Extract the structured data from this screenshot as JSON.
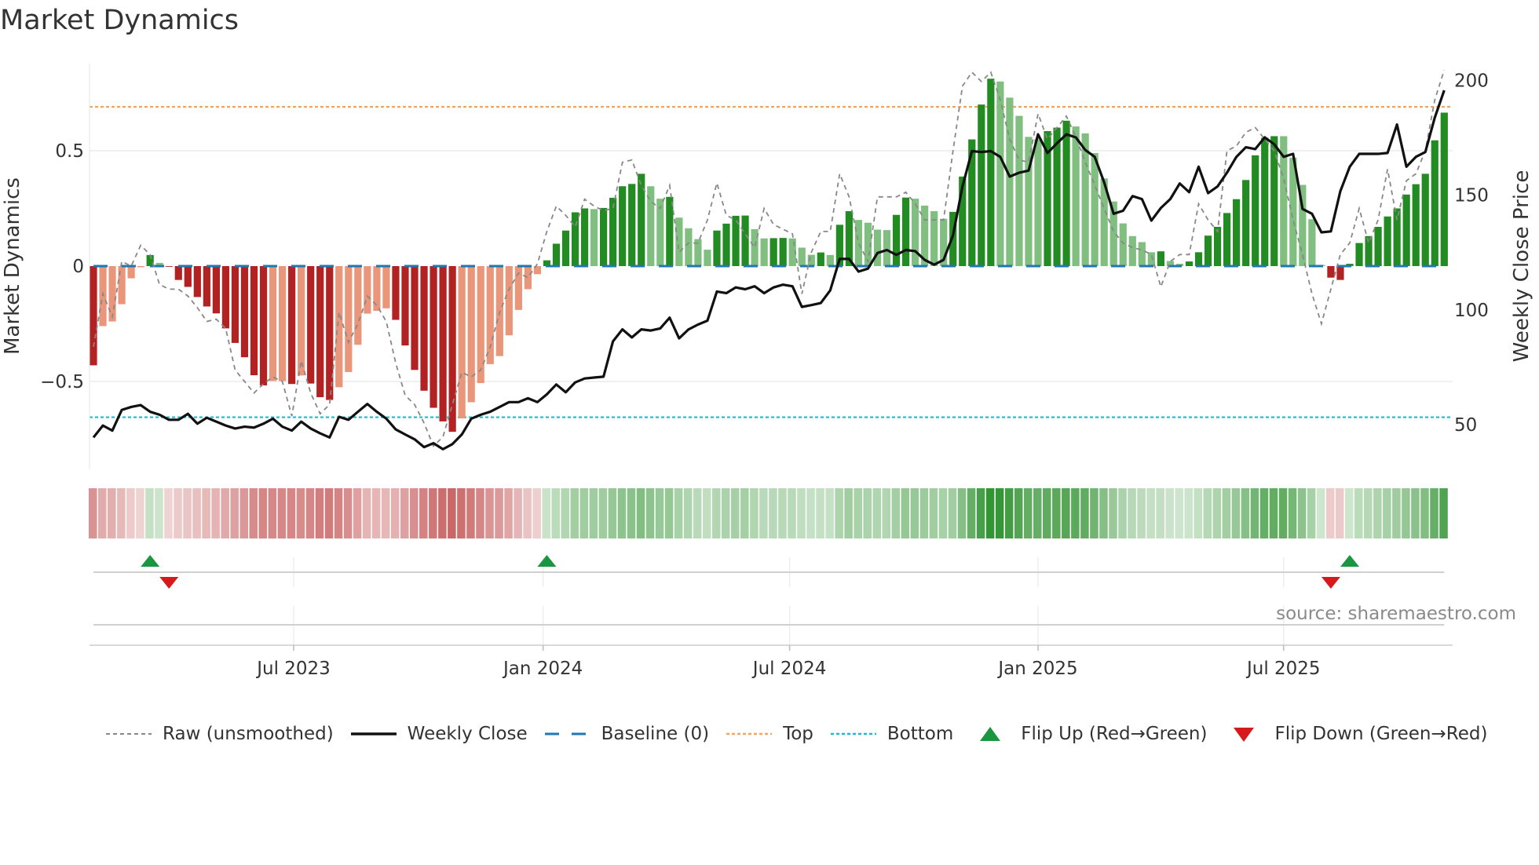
{
  "title": "Market Dynamics",
  "source": "source: sharemaestro.com",
  "legend": {
    "raw": "Raw (unsmoothed)",
    "close": "Weekly Close",
    "baseline": "Baseline (0)",
    "top": "Top",
    "bottom": "Bottom",
    "flip_up": "Flip Up (Red→Green)",
    "flip_down": "Flip Down (Green→Red)"
  },
  "colors": {
    "pos_strong": "#228b22",
    "pos_weak": "#80bf80",
    "neg_strong": "#b22222",
    "neg_weak": "#e9967a",
    "baseline": "#1f77b4",
    "top": "#f4a460",
    "bottom": "#17becf",
    "raw": "#888888",
    "close": "#111111",
    "flip_up": "#1a9641",
    "flip_down": "#d7191c"
  },
  "chart_data": {
    "type": "bar",
    "title": "Market Dynamics",
    "ylabel": "Market Dynamics",
    "y2label": "Weekly Close Price",
    "ylim": [
      -0.86,
      0.88
    ],
    "y2lim": [
      34,
      207
    ],
    "yticks": [
      {
        "v": 0.5,
        "label": "0.5"
      },
      {
        "v": 0,
        "label": "0"
      },
      {
        "v": -0.5,
        "label": "−0.5"
      }
    ],
    "y2ticks": [
      {
        "v": 200,
        "label": "200"
      },
      {
        "v": 150,
        "label": "150"
      },
      {
        "v": 100,
        "label": "100"
      },
      {
        "v": 50,
        "label": "50"
      }
    ],
    "xticks": [
      {
        "i": 21.2,
        "label": "Jul 2023"
      },
      {
        "i": 47.6,
        "label": "Jan 2024"
      },
      {
        "i": 73.7,
        "label": "Jul 2024"
      },
      {
        "i": 100,
        "label": "Jan 2025"
      },
      {
        "i": 126,
        "label": "Jul 2025"
      }
    ],
    "top": 0.69,
    "bottom": -0.655,
    "baseline": 0,
    "values": [
      -0.43,
      -0.26,
      -0.24,
      -0.165,
      -0.053,
      -0.005,
      0.048,
      0.014,
      -0.003,
      -0.06,
      -0.09,
      -0.134,
      -0.175,
      -0.205,
      -0.27,
      -0.333,
      -0.395,
      -0.473,
      -0.517,
      -0.498,
      -0.498,
      -0.511,
      -0.474,
      -0.509,
      -0.568,
      -0.58,
      -0.525,
      -0.459,
      -0.341,
      -0.206,
      -0.194,
      -0.183,
      -0.233,
      -0.344,
      -0.45,
      -0.54,
      -0.614,
      -0.673,
      -0.718,
      -0.66,
      -0.59,
      -0.507,
      -0.425,
      -0.39,
      -0.3,
      -0.19,
      -0.1,
      -0.035,
      0.025,
      0.097,
      0.154,
      0.233,
      0.25,
      0.247,
      0.252,
      0.296,
      0.346,
      0.356,
      0.4,
      0.346,
      0.292,
      0.3,
      0.21,
      0.164,
      0.117,
      0.071,
      0.154,
      0.184,
      0.218,
      0.219,
      0.16,
      0.12,
      0.121,
      0.122,
      0.12,
      0.08,
      0.049,
      0.059,
      0.048,
      0.179,
      0.238,
      0.2,
      0.188,
      0.158,
      0.156,
      0.222,
      0.297,
      0.292,
      0.262,
      0.238,
      0.205,
      0.235,
      0.388,
      0.549,
      0.7,
      0.812,
      0.8,
      0.73,
      0.651,
      0.56,
      0.55,
      0.585,
      0.6,
      0.63,
      0.605,
      0.575,
      0.49,
      0.38,
      0.28,
      0.185,
      0.13,
      0.104,
      0.06,
      0.064,
      0.022,
      0.01,
      0.02,
      0.06,
      0.132,
      0.17,
      0.23,
      0.29,
      0.373,
      0.48,
      0.556,
      0.563,
      0.563,
      0.47,
      0.352,
      0.203,
      0.005,
      -0.05,
      -0.06,
      0.01,
      0.1,
      0.13,
      0.17,
      0.215,
      0.25,
      0.31,
      0.355,
      0.4,
      0.545,
      0.665
    ],
    "raw": [
      -0.35,
      -0.12,
      -0.22,
      0.02,
      0.0,
      0.09,
      0.05,
      -0.08,
      -0.1,
      -0.1,
      -0.13,
      -0.18,
      -0.24,
      -0.23,
      -0.27,
      -0.45,
      -0.5,
      -0.55,
      -0.51,
      -0.48,
      -0.5,
      -0.65,
      -0.41,
      -0.55,
      -0.64,
      -0.6,
      -0.2,
      -0.33,
      -0.25,
      -0.13,
      -0.17,
      -0.24,
      -0.42,
      -0.56,
      -0.6,
      -0.68,
      -0.78,
      -0.74,
      -0.6,
      -0.46,
      -0.48,
      -0.45,
      -0.35,
      -0.2,
      -0.1,
      -0.03,
      -0.05,
      0.01,
      0.15,
      0.26,
      0.22,
      0.17,
      0.29,
      0.26,
      0.24,
      0.25,
      0.45,
      0.46,
      0.35,
      0.28,
      0.25,
      0.35,
      0.06,
      0.1,
      0.1,
      0.2,
      0.36,
      0.22,
      0.2,
      0.14,
      0.08,
      0.25,
      0.18,
      0.16,
      0.14,
      -0.12,
      0.06,
      0.15,
      0.15,
      0.4,
      0.3,
      0.1,
      0.02,
      0.3,
      0.3,
      0.3,
      0.32,
      0.27,
      0.2,
      0.2,
      0.2,
      0.5,
      0.78,
      0.84,
      0.8,
      0.84,
      0.72,
      0.55,
      0.46,
      0.45,
      0.66,
      0.55,
      0.6,
      0.65,
      0.56,
      0.45,
      0.35,
      0.25,
      0.15,
      0.1,
      0.08,
      0.07,
      0.05,
      -0.09,
      0.02,
      0.05,
      0.05,
      0.27,
      0.2,
      0.15,
      0.5,
      0.52,
      0.58,
      0.6,
      0.55,
      0.5,
      0.38,
      0.2,
      0.05,
      -0.12,
      -0.25,
      -0.1,
      0.05,
      0.1,
      0.25,
      0.1,
      0.2,
      0.42,
      0.2,
      0.37,
      0.4,
      0.5,
      0.72,
      0.85
    ],
    "close": [
      44.4,
      49.6,
      47.4,
      56.4,
      57.7,
      58.5,
      55.6,
      54.3,
      52.1,
      52.1,
      54.7,
      50.4,
      53,
      51.3,
      49.6,
      48.3,
      49.1,
      48.7,
      50.4,
      52.6,
      49.1,
      47.4,
      51.3,
      48.3,
      46.2,
      44.4,
      53.4,
      52.1,
      55.6,
      59,
      55.6,
      52.6,
      47.9,
      45.7,
      43.6,
      40.2,
      41.9,
      39.3,
      41.5,
      45.7,
      52.6,
      54.3,
      55.6,
      57.7,
      59.8,
      59.8,
      61.5,
      59.8,
      63.2,
      67.5,
      64.1,
      68.4,
      70.1,
      70.5,
      70.9,
      86.3,
      91.5,
      88.0,
      91.5,
      91.0,
      91.9,
      96.6,
      87.6,
      91.5,
      93.6,
      95.3,
      108,
      107.3,
      109.8,
      109,
      110.3,
      107.3,
      109.8,
      111,
      110.3,
      101.3,
      102.1,
      103,
      108.5,
      122.2,
      122.2,
      116.7,
      118,
      124.8,
      126.1,
      124,
      126.1,
      125.6,
      121.8,
      119.7,
      121.8,
      132.5,
      153.8,
      169.2,
      168.8,
      169.2,
      166.7,
      158.1,
      159.8,
      160.7,
      176.5,
      168.4,
      172.6,
      176.5,
      175.2,
      169.7,
      166.7,
      155.6,
      141.9,
      143.2,
      149.6,
      148.3,
      138.9,
      144.4,
      148.3,
      155.1,
      151.3,
      162.4,
      150.9,
      153.8,
      159.8,
      166.7,
      170.9,
      170.1,
      175.2,
      172.2,
      166.7,
      168,
      144,
      141.9,
      133.8,
      134.2,
      151.7,
      162.4,
      168,
      168,
      168,
      168.4,
      180.8,
      162.4,
      166.7,
      168.8,
      183.8,
      195.7
    ]
  },
  "flips": {
    "up": [
      6,
      48,
      133
    ],
    "down": [
      8,
      131
    ]
  }
}
